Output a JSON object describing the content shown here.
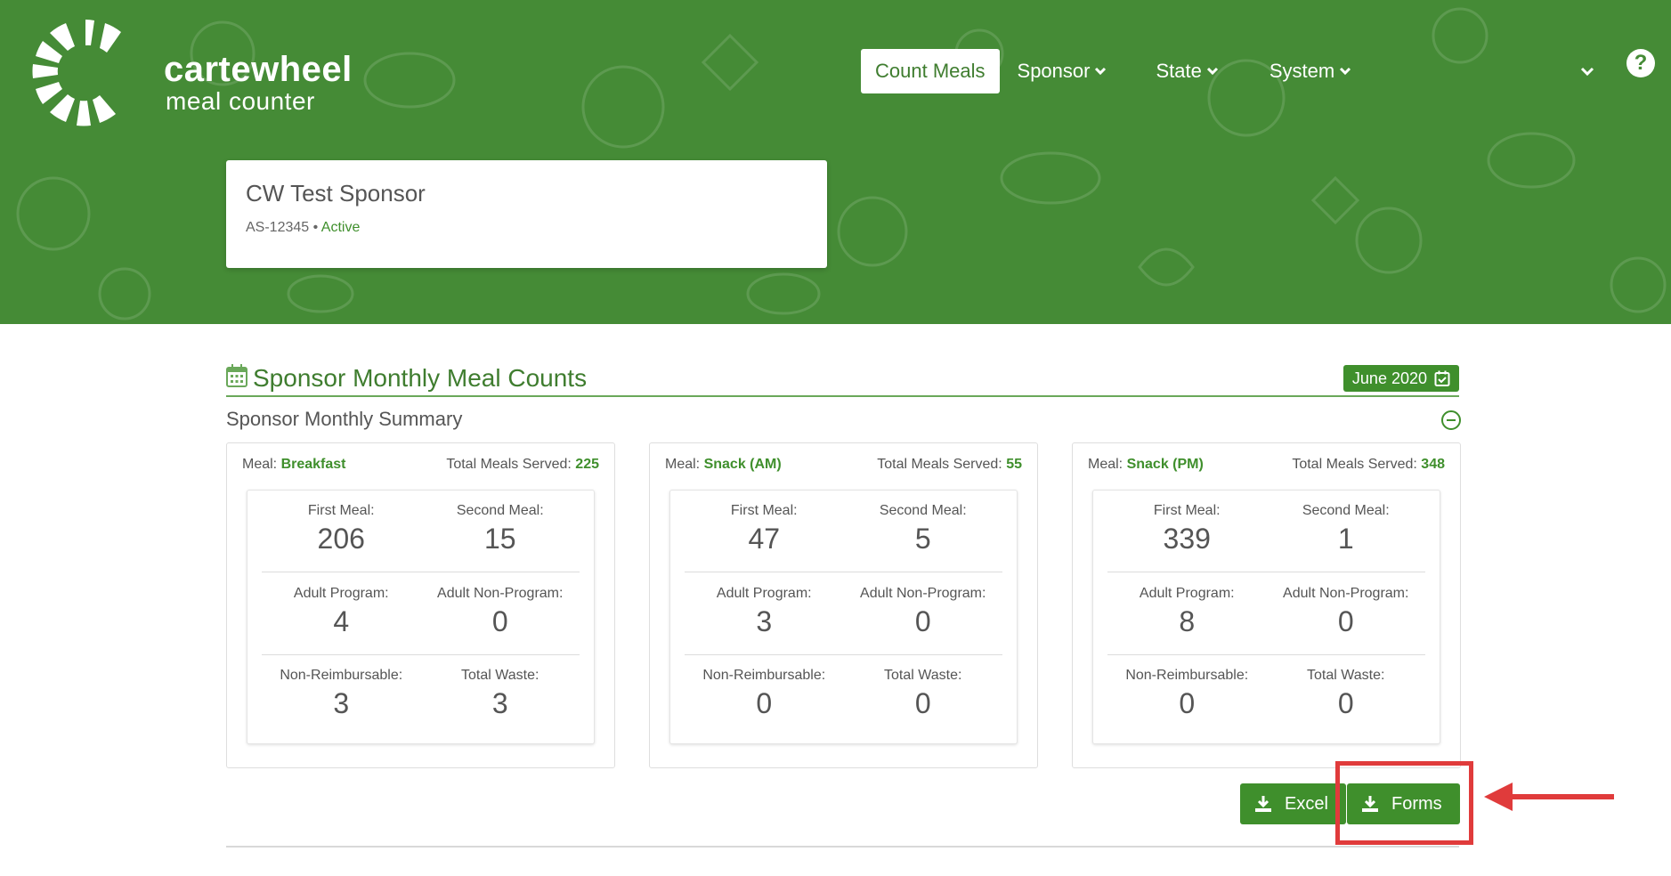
{
  "app": {
    "logo_word": "cartewheel",
    "logo_sub": "meal counter",
    "brand_green": "#458b36",
    "accent_green": "#3f8f2c"
  },
  "nav": {
    "count_meals": "Count Meals",
    "sponsor": "Sponsor",
    "state": "State",
    "system": "System",
    "help": "?"
  },
  "sponsor": {
    "name": "CW Test Sponsor",
    "id": "AS-12345",
    "separator": "•",
    "status": "Active"
  },
  "section": {
    "title": "Sponsor Monthly Meal Counts",
    "month": "June 2020",
    "summary_title": "Sponsor Monthly Summary"
  },
  "labels": {
    "meal": "Meal:",
    "total": "Total Meals Served:",
    "first": "First Meal:",
    "second": "Second Meal:",
    "adult_program": "Adult Program:",
    "adult_non_program": "Adult Non-Program:",
    "non_reimbursable": "Non-Reimbursable:",
    "total_waste": "Total Waste:"
  },
  "meals": [
    {
      "name": "Breakfast",
      "total": "225",
      "first": "206",
      "second": "15",
      "adult_program": "4",
      "adult_non_program": "0",
      "non_reimbursable": "3",
      "total_waste": "3"
    },
    {
      "name": "Snack (AM)",
      "total": "55",
      "first": "47",
      "second": "5",
      "adult_program": "3",
      "adult_non_program": "0",
      "non_reimbursable": "0",
      "total_waste": "0"
    },
    {
      "name": "Snack (PM)",
      "total": "348",
      "first": "339",
      "second": "1",
      "adult_program": "8",
      "adult_non_program": "0",
      "non_reimbursable": "0",
      "total_waste": "0"
    }
  ],
  "actions": {
    "excel": "Excel",
    "forms": "Forms"
  },
  "annotation": {
    "highlight_color": "#e03b3b"
  }
}
